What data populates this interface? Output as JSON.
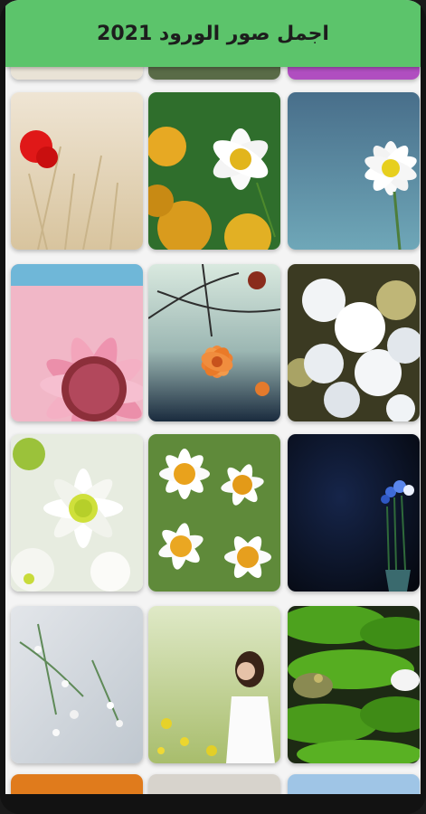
{
  "app": {
    "title": "اجمل صور الورود 2021"
  },
  "colors": {
    "appbar": "#5cc46b",
    "background": "#f4f4f4"
  },
  "gallery": {
    "items": [
      {
        "subject": "red-poppy-wheat"
      },
      {
        "subject": "white-daisy-yellow-field"
      },
      {
        "subject": "white-narcissus-blue"
      },
      {
        "subject": "pink-gerbera"
      },
      {
        "subject": "orange-blossom-branches"
      },
      {
        "subject": "white-hydrangea"
      },
      {
        "subject": "white-chrysanthemums"
      },
      {
        "subject": "daisy-field"
      },
      {
        "subject": "blue-flowers-dark"
      },
      {
        "subject": "small-white-buds"
      },
      {
        "subject": "girl-in-meadow"
      },
      {
        "subject": "frog-lily-pads"
      }
    ]
  }
}
